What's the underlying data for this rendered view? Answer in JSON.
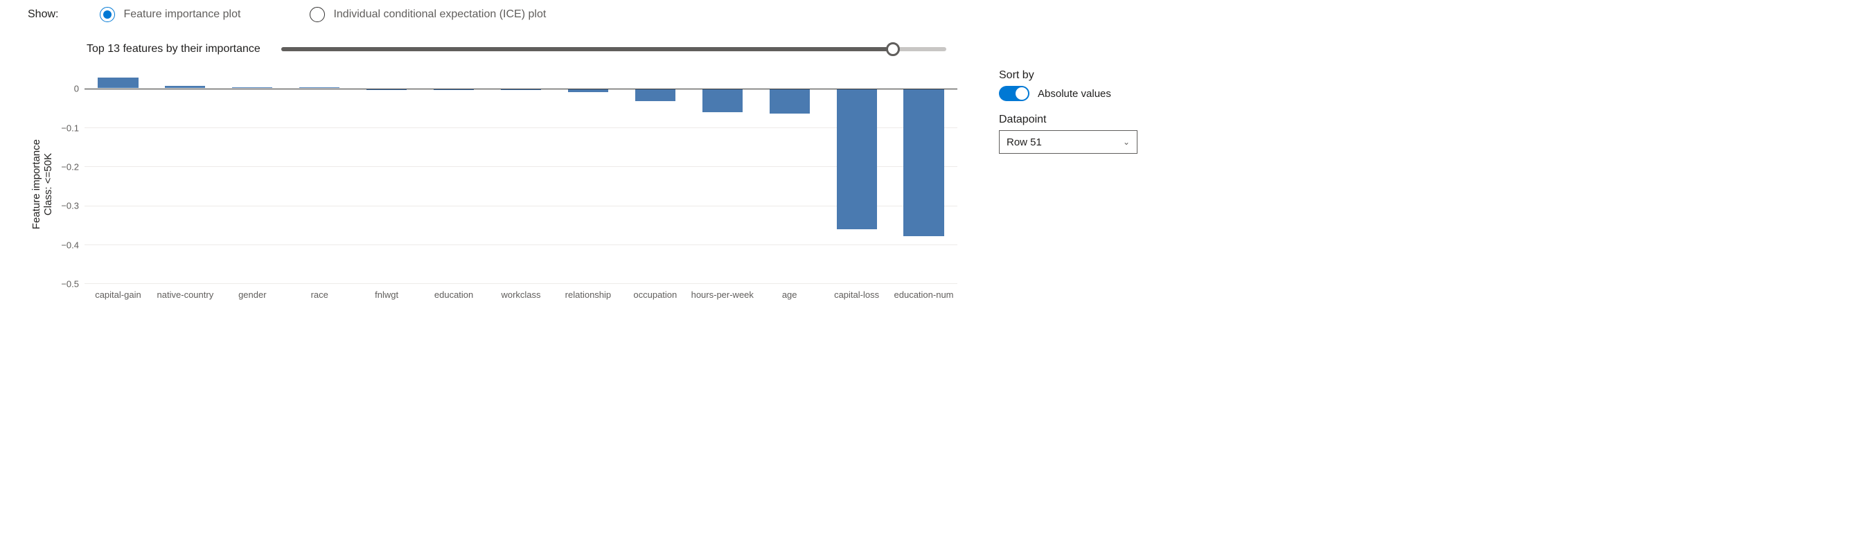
{
  "show_label": "Show:",
  "radios": {
    "feature_importance": "Feature importance plot",
    "ice": "Individual conditional expectation (ICE) plot",
    "selected": "feature_importance"
  },
  "slider": {
    "title": "Top 13 features by their importance",
    "value": 13,
    "max": 14,
    "fill_pct": 92
  },
  "chart_data": {
    "type": "bar",
    "ylabel": "Feature importance\nClass: <=50K",
    "ylim": [
      -0.5,
      0.05
    ],
    "yticks": [
      0,
      -0.1,
      -0.2,
      -0.3,
      -0.4,
      -0.5
    ],
    "categories": [
      "capital-gain",
      "native-country",
      "gender",
      "race",
      "fnlwgt",
      "education",
      "workclass",
      "relationship",
      "occupation",
      "hours-per-week",
      "age",
      "capital-loss",
      "education-num"
    ],
    "values": [
      0.027,
      0.005,
      0.003,
      0.002,
      -0.003,
      -0.004,
      -0.004,
      -0.008,
      -0.032,
      -0.06,
      -0.063,
      -0.36,
      -0.378
    ]
  },
  "side": {
    "sort_label": "Sort by",
    "toggle_label": "Absolute values",
    "toggle_on": true,
    "datapoint_label": "Datapoint",
    "datapoint_value": "Row 51"
  },
  "colors": {
    "bar": "#4a7ab0",
    "accent": "#0078d4"
  }
}
